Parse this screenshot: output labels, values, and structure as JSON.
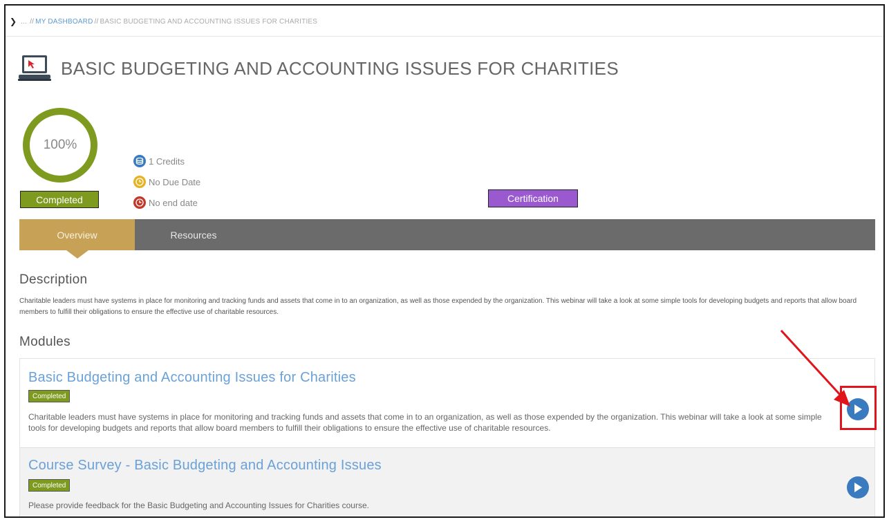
{
  "breadcrumb": {
    "prefix": "...",
    "sep1": "//",
    "dashboard": "MY DASHBOARD",
    "sep2": "//",
    "current": "BASIC BUDGETING AND ACCOUNTING ISSUES FOR CHARITIES"
  },
  "course": {
    "title": "BASIC BUDGETING AND ACCOUNTING ISSUES FOR CHARITIES",
    "progress": "100%",
    "progress_fraction": 1.0,
    "status": "Completed",
    "credits": "1 Credits",
    "due_date": "No Due Date",
    "end_date": "No end date",
    "certification_label": "Certification"
  },
  "tabs": [
    {
      "label": "Overview",
      "active": true
    },
    {
      "label": "Resources",
      "active": false
    }
  ],
  "description": {
    "heading": "Description",
    "text": "Charitable leaders must have systems in place for monitoring and tracking funds and assets that come in to an organization, as well as those expended by the organization. This webinar will take a look at some simple tools for developing budgets and reports that allow board members to fulfill their obligations to ensure the effective use of charitable resources."
  },
  "modules": {
    "heading": "Modules",
    "items": [
      {
        "title": "Basic Budgeting and Accounting Issues for Charities",
        "status": "Completed",
        "description": "Charitable leaders must have systems in place for monitoring and tracking funds and assets that come in to an organization, as well as those expended by the organization. This webinar will take a look at some simple tools for developing budgets and reports that allow board members to fulfill their obligations to ensure the effective use of charitable resources."
      },
      {
        "title": "Course Survey - Basic Budgeting and Accounting Issues",
        "status": "Completed",
        "description": "Please provide feedback for the Basic Budgeting and Accounting Issues for Charities course."
      }
    ]
  },
  "colors": {
    "accent_green": "#7e9a1f",
    "tab_gold": "#c7a256",
    "tab_bar_gray": "#6b6b6b",
    "certification_purple": "#9b59d0",
    "link_blue": "#6aa1d8",
    "play_blue": "#3a7bbf",
    "annotation_red": "#e0141b"
  },
  "icons": {
    "breadcrumb_toggle": "chevron-right-icon",
    "course_type": "laptop-icon",
    "credits": "coins-icon",
    "due_date": "clock-icon",
    "end_date": "clock-icon",
    "module_action": "play-icon"
  }
}
